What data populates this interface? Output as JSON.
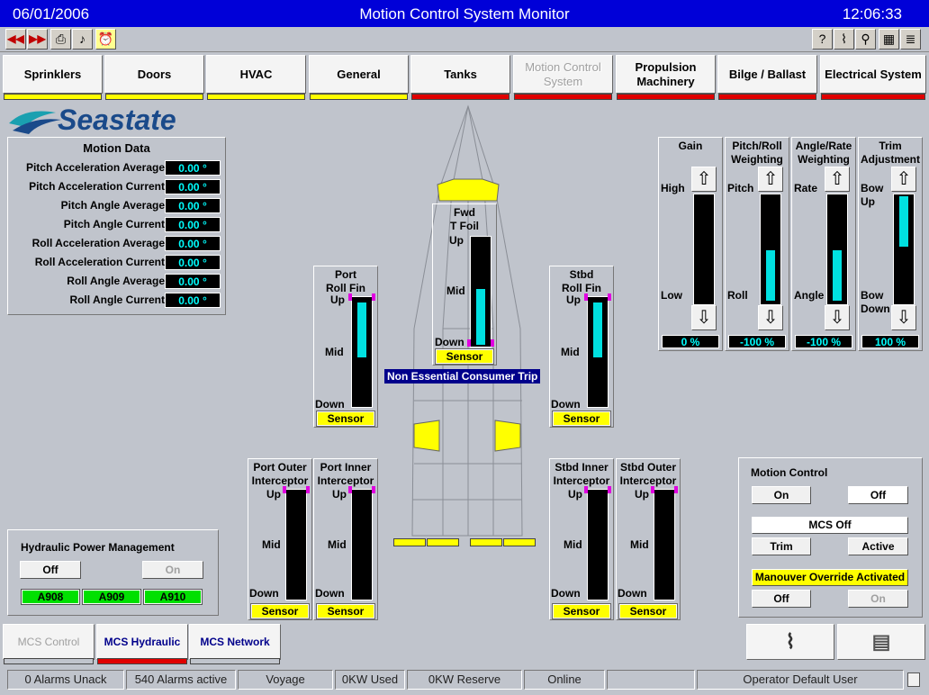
{
  "title": {
    "date": "06/01/2006",
    "app": "Motion Control System Monitor",
    "time": "12:06:33"
  },
  "toolbar": {
    "left_icons": [
      "rewind-icon",
      "fast-forward-icon",
      "printer-icon",
      "music-note-icon",
      "alarm-clock-icon"
    ],
    "right_icons": [
      "help-icon",
      "chart-icon",
      "magnifier-icon",
      "calculator-icon",
      "notepad-icon"
    ]
  },
  "nav": [
    {
      "label": "Sprinklers",
      "status_color": "#ffff00",
      "enabled": true
    },
    {
      "label": "Doors",
      "status_color": "#ffff00",
      "enabled": true
    },
    {
      "label": "HVAC",
      "status_color": "#ffff00",
      "enabled": true
    },
    {
      "label": "General",
      "status_color": "#ffff00",
      "enabled": true
    },
    {
      "label": "Tanks",
      "status_color": "#e00000",
      "enabled": true
    },
    {
      "label": "Motion Control System",
      "status_color": "#e00000",
      "enabled": false
    },
    {
      "label": "Propulsion Machinery",
      "status_color": "#e00000",
      "enabled": true
    },
    {
      "label": "Bilge / Ballast",
      "status_color": "#e00000",
      "enabled": true
    },
    {
      "label": "Electrical System",
      "status_color": "#e00000",
      "enabled": true
    }
  ],
  "logo": {
    "text": "Seastate",
    "color": "#1a4a8a",
    "accent": "#1aa0b0"
  },
  "motion_data": {
    "title": "Motion Data",
    "rows": [
      {
        "label": "Pitch Acceleration Average",
        "value": "0.00 °"
      },
      {
        "label": "Pitch Acceleration Current",
        "value": "0.00 °"
      },
      {
        "label": "Pitch Angle Average",
        "value": "0.00 °"
      },
      {
        "label": "Pitch Angle Current",
        "value": "0.00 °"
      },
      {
        "label": "Roll Acceleration Average",
        "value": "0.00 °"
      },
      {
        "label": "Roll Acceleration Current",
        "value": "0.00 °"
      },
      {
        "label": "Roll Angle Average",
        "value": "0.00 °"
      },
      {
        "label": "Roll Angle Current",
        "value": "0.00 °"
      }
    ]
  },
  "gauge_labels": {
    "up": "Up",
    "mid": "Mid",
    "down": "Down",
    "sensor": "Sensor"
  },
  "fins": {
    "fwd": {
      "title": "Fwd\nT Foil",
      "level": 0.55,
      "fill_top": 0.45,
      "fill_bottom": 0.98
    },
    "port_roll": {
      "title": "Port\nRoll Fin",
      "fill_top": 0.03,
      "fill_bottom": 0.52
    },
    "stbd_roll": {
      "title": "Stbd\nRoll Fin",
      "fill_top": 0.03,
      "fill_bottom": 0.52
    }
  },
  "interceptors": {
    "port_outer": {
      "title": "Port Outer\nInterceptor"
    },
    "port_inner": {
      "title": "Port Inner\nInterceptor"
    },
    "stbd_inner": {
      "title": "Stbd Inner\nInterceptor"
    },
    "stbd_outer": {
      "title": "Stbd Outer\nInterceptor"
    }
  },
  "trip_message": "Non Essential Consumer Trip",
  "controls": [
    {
      "title": "Gain",
      "top_label": "High",
      "bottom_label": "Low",
      "value": "0 %",
      "fill_top": 0,
      "fill_bottom": 0
    },
    {
      "title": "Pitch/Roll\nWeighting",
      "top_label": "Pitch",
      "bottom_label": "Roll",
      "value": "-100 %",
      "fill_top": 0.5,
      "fill_bottom": 1.0
    },
    {
      "title": "Angle/Rate\nWeighting",
      "top_label": "Rate",
      "bottom_label": "Angle",
      "value": "-100 %",
      "fill_top": 0.5,
      "fill_bottom": 1.0
    },
    {
      "title": "Trim\nAdjustment",
      "top_label": "Bow\nUp",
      "bottom_label": "Bow\nDown",
      "value": "100 %",
      "fill_top": 0.0,
      "fill_bottom": 0.5
    }
  ],
  "hydraulic": {
    "title": "Hydraulic Power Management",
    "off": "Off",
    "on": "On",
    "alarms": [
      "A908",
      "A909",
      "A910"
    ]
  },
  "motion_control": {
    "title": "Motion Control",
    "on": "On",
    "off": "Off",
    "status": "MCS Off",
    "trim": "Trim",
    "active": "Active",
    "override": "Manouver Override Activated",
    "override_off": "Off",
    "override_on": "On"
  },
  "bottom_tabs": [
    {
      "label": "MCS Control",
      "status_color": "#c0c4cc",
      "enabled": false
    },
    {
      "label": "MCS Hydraulic",
      "status_color": "#e00000",
      "enabled": true
    },
    {
      "label": "MCS Network",
      "status_color": "#c0c4cc",
      "enabled": true
    }
  ],
  "bottom_icons": [
    "trend-chart-icon",
    "report-icon"
  ],
  "status": [
    "0 Alarms Unack",
    "540 Alarms active",
    "Voyage",
    "0KW Used",
    "0KW Reserve",
    "Online",
    "",
    "Operator Default User"
  ]
}
